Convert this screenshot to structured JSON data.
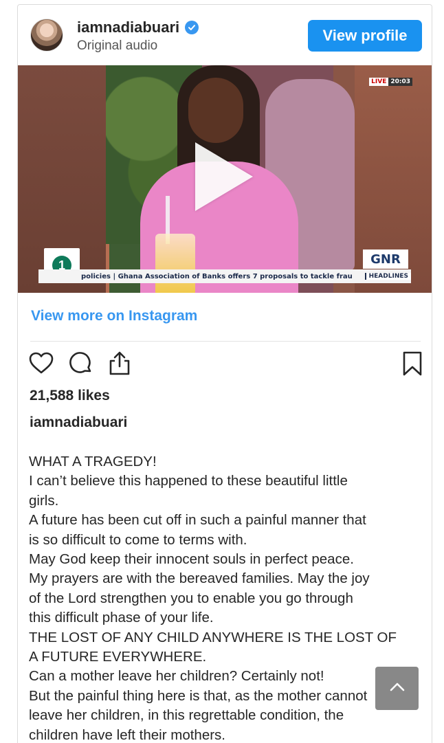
{
  "post": {
    "username": "iamnadiabuari",
    "subtitle": "Original audio",
    "view_profile_label": "View profile"
  },
  "video": {
    "live_label": "LIVE",
    "live_time": "20:03",
    "channel_logo_right": "GNR",
    "ticker_text": "policies | Ghana Association of Banks offers 7 proposals to tackle frau",
    "ticker_tag": "HEADLINES"
  },
  "view_more_label": "View more on Instagram",
  "likes": "21,588 likes",
  "caption_author": "iamnadiabuari",
  "caption_lines": [
    "WHAT A TRAGEDY!",
    "I can’t believe this happened to these beautiful little",
    "girls.",
    "A future has been cut off in such a painful manner that",
    "is so difficult to come to terms with.",
    "May God keep their innocent souls in perfect peace.",
    "My prayers are with the bereaved families. May the joy",
    "of the Lord strengthen you to enable you go through",
    "this difficult phase of your life.",
    "THE LOST OF ANY CHILD ANYWHERE IS THE LOST OF",
    "A FUTURE EVERYWHERE.",
    "Can a mother leave her children? Certainly not!",
    "But the painful thing here is that, as the mother cannot",
    "leave her children, in this regrettable condition, the",
    "children have left their mothers."
  ],
  "colors": {
    "accent": "#3897f0",
    "button": "#1a92f0",
    "shirt": "#ea86c7"
  },
  "icons": [
    "verified-badge-icon",
    "play-icon",
    "heart-icon",
    "comment-icon",
    "share-icon",
    "bookmark-icon",
    "chevron-up-icon"
  ]
}
